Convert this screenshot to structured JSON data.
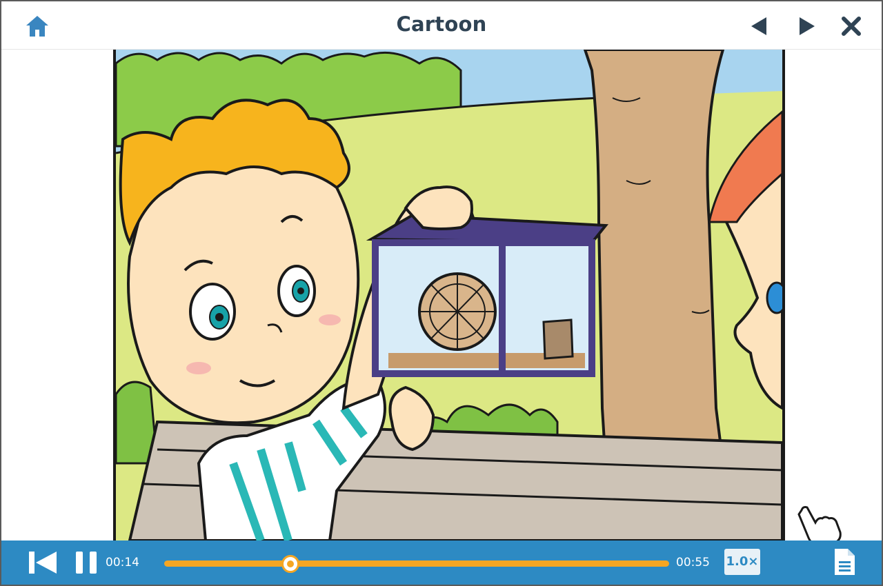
{
  "header": {
    "title": "Cartoon",
    "home_icon": "home-icon",
    "prev_icon": "triangle-left-icon",
    "next_icon": "triangle-right-icon",
    "close_icon": "close-icon"
  },
  "player": {
    "current_time": "00:14",
    "total_time": "00:55",
    "progress": 0.25,
    "speed_label": "1.0×",
    "rewind_icon": "skip-back-icon",
    "pause_icon": "pause-icon",
    "transcript_icon": "document-icon"
  },
  "colors": {
    "title_text": "#2f4354",
    "nav_icon": "#2f4354",
    "home_icon": "#3a86c0",
    "control_bar": "#2d8ac3",
    "progress": "#f5a623"
  }
}
